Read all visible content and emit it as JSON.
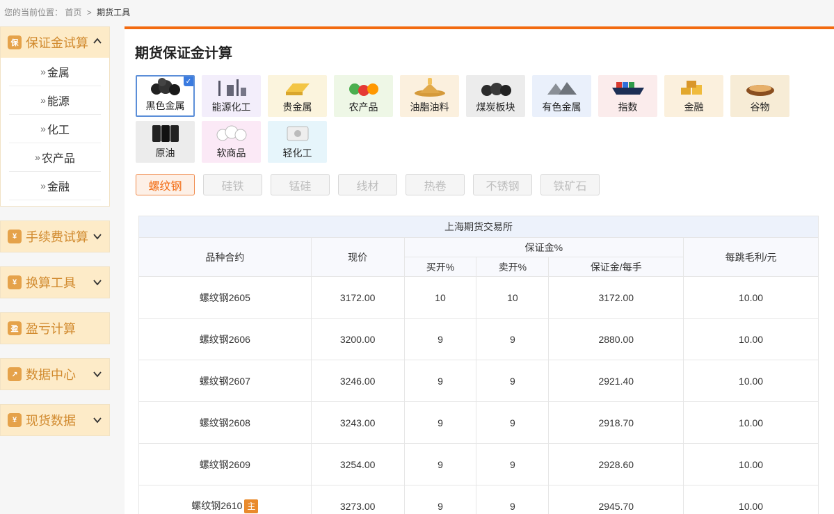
{
  "breadcrumb": {
    "prefix": "您的当前位置：",
    "home": "首页",
    "sep": ">",
    "current": "期货工具"
  },
  "sidebar": {
    "margin_calc": {
      "title": "保证金试算",
      "icon_char": "保",
      "items": [
        "金属",
        "能源",
        "化工",
        "农产品",
        "金融"
      ]
    },
    "fee_calc": {
      "title": "手续费试算",
      "icon_char": "¥"
    },
    "convert_tools": {
      "title": "换算工具",
      "icon_char": "¥"
    },
    "pnl_calc": {
      "title": "盈亏计算",
      "icon_char": "盈"
    },
    "data_center": {
      "title": "数据中心",
      "icon_char": "↗"
    },
    "spot_data": {
      "title": "现货数据",
      "icon_char": "¥"
    }
  },
  "page_title": "期货保证金计算",
  "categories": [
    {
      "label": "黑色金属",
      "bg": "#ffffff",
      "icon": "coal-lumps-icon",
      "active": true
    },
    {
      "label": "能源化工",
      "bg": "#f3eefb",
      "icon": "refinery-icon"
    },
    {
      "label": "贵金属",
      "bg": "#fbf4dd",
      "icon": "gold-bar-icon"
    },
    {
      "label": "农产品",
      "bg": "#eef7e6",
      "icon": "vegetables-icon"
    },
    {
      "label": "油脂油料",
      "bg": "#fbf0de",
      "icon": "oil-seeds-icon"
    },
    {
      "label": "煤炭板块",
      "bg": "#ececec",
      "icon": "coal-icon"
    },
    {
      "label": "有色金属",
      "bg": "#eaf0fb",
      "icon": "metal-scrap-icon"
    },
    {
      "label": "指数",
      "bg": "#fbecec",
      "icon": "container-ship-icon"
    },
    {
      "label": "金融",
      "bg": "#fbf0dd",
      "icon": "gold-stack-icon"
    },
    {
      "label": "谷物",
      "bg": "#f7ecd6",
      "icon": "grain-bowl-icon"
    },
    {
      "label": "原油",
      "bg": "#ececec",
      "icon": "oil-barrel-icon"
    },
    {
      "label": "软商品",
      "bg": "#fbe9f6",
      "icon": "cotton-icon"
    },
    {
      "label": "轻化工",
      "bg": "#e6f5fb",
      "icon": "paper-roll-icon"
    }
  ],
  "products": [
    {
      "label": "螺纹钢",
      "active": true
    },
    {
      "label": "硅铁"
    },
    {
      "label": "锰硅"
    },
    {
      "label": "线材"
    },
    {
      "label": "热卷"
    },
    {
      "label": "不锈钢"
    },
    {
      "label": "铁矿石"
    }
  ],
  "table": {
    "exchange": "上海期货交易所",
    "headers": {
      "contract": "品种合约",
      "price": "现价",
      "margin_group": "保证金%",
      "buy": "买开%",
      "sell": "卖开%",
      "per_lot": "保证金/每手",
      "tick_profit": "每跳毛利/元"
    },
    "main_badge": "主",
    "rows": [
      {
        "contract": "螺纹钢2605",
        "price": "3172.00",
        "buy": "10",
        "sell": "10",
        "per_lot": "3172.00",
        "tick": "10.00",
        "main": false
      },
      {
        "contract": "螺纹钢2606",
        "price": "3200.00",
        "buy": "9",
        "sell": "9",
        "per_lot": "2880.00",
        "tick": "10.00",
        "main": false
      },
      {
        "contract": "螺纹钢2607",
        "price": "3246.00",
        "buy": "9",
        "sell": "9",
        "per_lot": "2921.40",
        "tick": "10.00",
        "main": false
      },
      {
        "contract": "螺纹钢2608",
        "price": "3243.00",
        "buy": "9",
        "sell": "9",
        "per_lot": "2918.70",
        "tick": "10.00",
        "main": false
      },
      {
        "contract": "螺纹钢2609",
        "price": "3254.00",
        "buy": "9",
        "sell": "9",
        "per_lot": "2928.60",
        "tick": "10.00",
        "main": false
      },
      {
        "contract": "螺纹钢2610",
        "price": "3273.00",
        "buy": "9",
        "sell": "9",
        "per_lot": "2945.70",
        "tick": "10.00",
        "main": true
      }
    ]
  },
  "colors": {
    "accent": "#f26a10",
    "sidebar_head": "#fdebc8",
    "sidebar_text": "#d18a2e",
    "active_border": "#5b8ed8"
  }
}
